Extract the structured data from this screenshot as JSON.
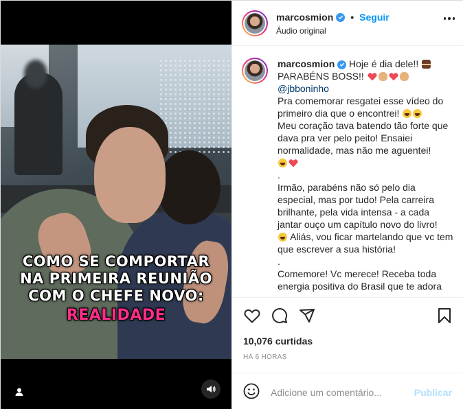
{
  "header": {
    "username": "marcosmion",
    "separator": "•",
    "follow_label": "Seguir",
    "subtitle": "Áudio original"
  },
  "video": {
    "caption_lines": [
      "COMO SE COMPORTAR",
      "NA PRIMEIRA REUNIÃO",
      "COM O CHEFE NOVO:",
      "REALIDADE"
    ]
  },
  "caption": {
    "username": "marcosmion",
    "line1": " Hoje é dia dele!! ",
    "line2": "PARABÉNS BOSS!! ",
    "mention": "@jbboninho",
    "p1": "Pra comemorar resgatei esse vídeo do primeiro dia que o encontrei! ",
    "p2": "Meu coração tava batendo tão forte que dava pra ver pelo peito! Ensaiei normalidade, mas não me aguentei!",
    "sep1": ".",
    "p3": "Irmão, parabéns não só pelo dia especial, mas por tudo! Pela carreira brilhante, pela vida intensa - a cada jantar ouço um capítulo novo do livro!",
    "p4": " Aliás, vou ficar martelando que vc tem que escrever a sua história!",
    "sep2": ".",
    "p5": "Comemore! Vc merece! Receba toda energia positiva do Brasil que te adora"
  },
  "stats": {
    "likes": "10,076 curtidas",
    "time": "HÁ 6 HORAS"
  },
  "comment_box": {
    "placeholder": "Adicione um comentário...",
    "post_label": "Publicar"
  },
  "colors": {
    "accent": "#0095f6",
    "verified": "#3897f0",
    "publish_disabled": "#b2dffc",
    "caption_highlight": "#ff2d8a",
    "heart": "#ed4956"
  },
  "icons": [
    "verified-badge-icon",
    "more-options-icon",
    "heart-icon",
    "comment-icon",
    "share-icon",
    "bookmark-icon",
    "emoji-icon",
    "user-tag-icon",
    "mute-icon",
    "cake-emoji",
    "red-heart-emoji",
    "clap-emoji",
    "laughing-emoji"
  ]
}
